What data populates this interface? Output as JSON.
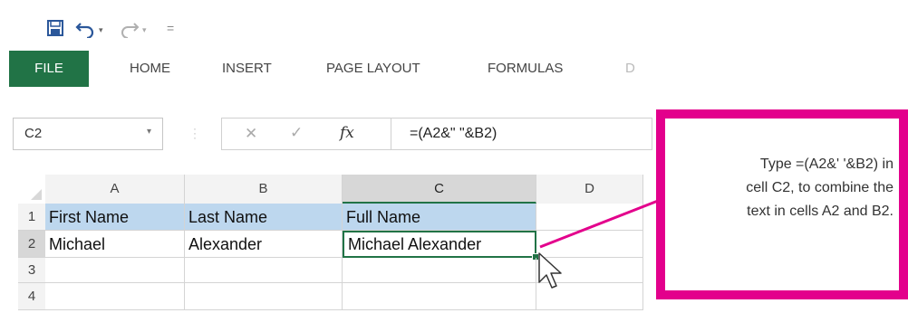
{
  "qat": {
    "save_icon": "save-icon",
    "undo_icon": "undo-icon",
    "redo_icon": "redo-icon",
    "dropdown_glyph": "▾",
    "customize_glyph": "="
  },
  "ribbon": {
    "tabs": [
      {
        "label": "FILE"
      },
      {
        "label": "HOME"
      },
      {
        "label": "INSERT"
      },
      {
        "label": "PAGE LAYOUT"
      },
      {
        "label": "FORMULAS"
      },
      {
        "label": "D"
      }
    ]
  },
  "formula_bar": {
    "name_box": "C2",
    "cancel_glyph": "✕",
    "enter_glyph": "✓",
    "fx_label": "fx",
    "formula": "=(A2&\" \"&B2)"
  },
  "sheet": {
    "columns": [
      "A",
      "B",
      "C",
      "D"
    ],
    "rows": [
      "1",
      "2",
      "3",
      "4"
    ],
    "cells": {
      "A1": "First Name",
      "B1": "Last Name",
      "C1": "Full Name",
      "A2": "Michael",
      "B2": "Alexander",
      "C2": "Michael Alexander"
    },
    "active_cell": "C2"
  },
  "callout": {
    "lines": [
      "Type =(A2&' '&B2) in",
      "cell C2, to combine the",
      "text in cells A2 and B2."
    ],
    "border_color": "#e3008c"
  },
  "colors": {
    "accent": "#217346",
    "header_fill": "#bdd7ee",
    "callout": "#e3008c"
  }
}
